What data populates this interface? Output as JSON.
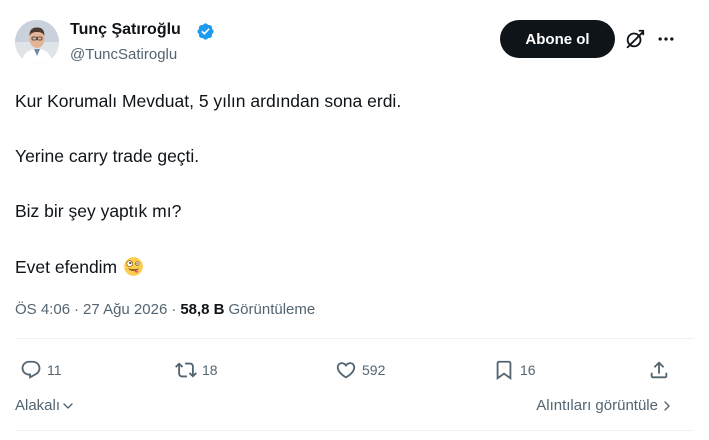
{
  "author": {
    "display_name": "Tunç Şatıroğlu",
    "handle": "@TuncSatiroglu",
    "verified": true,
    "verified_color": "#1d9bf0"
  },
  "header": {
    "subscribe_label": "Abone ol",
    "grok_icon": "grok-icon",
    "more_icon": "more-icon"
  },
  "tweet": {
    "lines": [
      "Kur Korumalı Mevduat, 5 yılın ardından sona erdi.",
      "Yerine carry trade geçti.",
      "Biz bir şey yaptık mı?",
      "Evet efendim"
    ],
    "emoji": "zany-face-emoji"
  },
  "meta": {
    "time": "ÖS 4:06",
    "separator": "·",
    "date": "27 Ağu 2026",
    "views_count": "58,8 B",
    "views_label": "Görüntüleme"
  },
  "actions": {
    "replies": "11",
    "retweets": "18",
    "likes": "592",
    "bookmarks": "16"
  },
  "footer": {
    "sort_label": "Alakalı",
    "quotes_label": "Alıntıları görüntüle"
  },
  "colors": {
    "text": "#0f1419",
    "secondary": "#536471",
    "button_bg": "#0f1419",
    "divider": "#eff3f4"
  }
}
